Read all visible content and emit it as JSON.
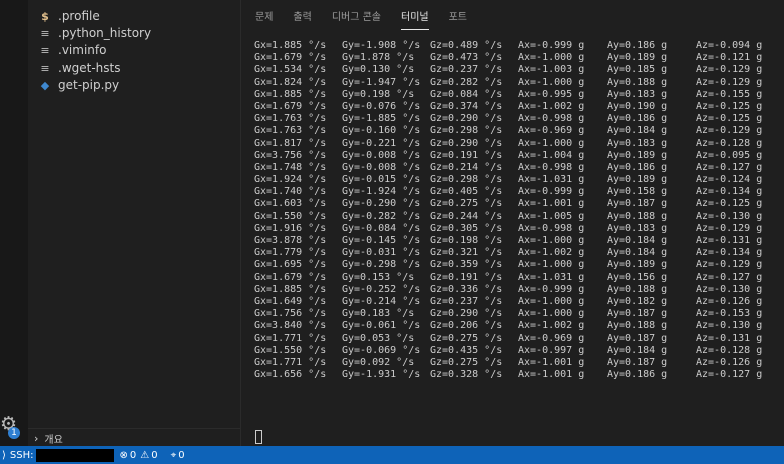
{
  "explorer": {
    "files": [
      {
        "name": ".profile",
        "icon": "dollar-icon"
      },
      {
        "name": ".python_history",
        "icon": "lines-icon"
      },
      {
        "name": ".viminfo",
        "icon": "lines-icon"
      },
      {
        "name": ".wget-hsts",
        "icon": "lines-icon"
      },
      {
        "name": "get-pip.py",
        "icon": "python-icon"
      }
    ],
    "outline_label": "개요"
  },
  "activity": {
    "settings_badge": "1"
  },
  "panel": {
    "tabs": [
      {
        "label": "문제"
      },
      {
        "label": "출력"
      },
      {
        "label": "디버그 콘솔"
      },
      {
        "label": "터미널",
        "active": true
      },
      {
        "label": "포트"
      }
    ],
    "terminal_lines": [
      [
        "Gx=1.885 °/s",
        "Gy=-1.908 °/s",
        "Gz=0.489 °/s",
        "Ax=-0.999 g",
        "Ay=0.186 g",
        "Az=-0.094 g"
      ],
      [
        "Gx=1.679 °/s",
        "Gy=1.878 °/s",
        "Gz=0.473 °/s",
        "Ax=-1.000 g",
        "Ay=0.189 g",
        "Az=-0.121 g"
      ],
      [
        "Gx=1.534 °/s",
        "Gy=0.130 °/s",
        "Gz=0.237 °/s",
        "Ax=-1.003 g",
        "Ay=0.185 g",
        "Az=-0.129 g"
      ],
      [
        "Gx=1.824 °/s",
        "Gy=-1.947 °/s",
        "Gz=0.282 °/s",
        "Ax=-1.000 g",
        "Ay=0.188 g",
        "Az=-0.129 g"
      ],
      [
        "Gx=1.885 °/s",
        "Gy=0.198 °/s",
        "Gz=0.084 °/s",
        "Ax=-0.995 g",
        "Ay=0.183 g",
        "Az=-0.155 g"
      ],
      [
        "Gx=1.679 °/s",
        "Gy=-0.076 °/s",
        "Gz=0.374 °/s",
        "Ax=-1.002 g",
        "Ay=0.190 g",
        "Az=-0.125 g"
      ],
      [
        "Gx=1.763 °/s",
        "Gy=-1.885 °/s",
        "Gz=0.290 °/s",
        "Ax=-0.998 g",
        "Ay=0.186 g",
        "Az=-0.125 g"
      ],
      [
        "Gx=1.763 °/s",
        "Gy=-0.160 °/s",
        "Gz=0.298 °/s",
        "Ax=-0.969 g",
        "Ay=0.184 g",
        "Az=-0.129 g"
      ],
      [
        "Gx=1.817 °/s",
        "Gy=-0.221 °/s",
        "Gz=0.290 °/s",
        "Ax=-1.000 g",
        "Ay=0.183 g",
        "Az=-0.128 g"
      ],
      [
        "Gx=3.756 °/s",
        "Gy=-0.008 °/s",
        "Gz=0.191 °/s",
        "Ax=-1.004 g",
        "Ay=0.189 g",
        "Az=-0.095 g"
      ],
      [
        "Gx=1.748 °/s",
        "Gy=-0.008 °/s",
        "Gz=0.214 °/s",
        "Ax=-0.998 g",
        "Ay=0.186 g",
        "Az=-0.127 g"
      ],
      [
        "Gx=1.924 °/s",
        "Gy=-0.015 °/s",
        "Gz=0.298 °/s",
        "Ax=-1.031 g",
        "Ay=0.189 g",
        "Az=-0.124 g"
      ],
      [
        "Gx=1.740 °/s",
        "Gy=-1.924 °/s",
        "Gz=0.405 °/s",
        "Ax=-0.999 g",
        "Ay=0.158 g",
        "Az=-0.134 g"
      ],
      [
        "Gx=1.603 °/s",
        "Gy=-0.290 °/s",
        "Gz=0.275 °/s",
        "Ax=-1.001 g",
        "Ay=0.187 g",
        "Az=-0.125 g"
      ],
      [
        "Gx=1.550 °/s",
        "Gy=-0.282 °/s",
        "Gz=0.244 °/s",
        "Ax=-1.005 g",
        "Ay=0.188 g",
        "Az=-0.130 g"
      ],
      [
        "Gx=1.916 °/s",
        "Gy=-0.084 °/s",
        "Gz=0.305 °/s",
        "Ax=-0.998 g",
        "Ay=0.183 g",
        "Az=-0.129 g"
      ],
      [
        "Gx=3.878 °/s",
        "Gy=-0.145 °/s",
        "Gz=0.198 °/s",
        "Ax=-1.000 g",
        "Ay=0.184 g",
        "Az=-0.131 g"
      ],
      [
        "Gx=1.779 °/s",
        "Gy=-0.031 °/s",
        "Gz=0.321 °/s",
        "Ax=-1.002 g",
        "Ay=0.184 g",
        "Az=-0.134 g"
      ],
      [
        "Gx=1.695 °/s",
        "Gy=-0.298 °/s",
        "Gz=0.359 °/s",
        "Ax=-1.000 g",
        "Ay=0.189 g",
        "Az=-0.129 g"
      ],
      [
        "Gx=1.679 °/s",
        "Gy=0.153 °/s",
        "Gz=0.191 °/s",
        "Ax=-1.031 g",
        "Ay=0.156 g",
        "Az=-0.127 g"
      ],
      [
        "Gx=1.885 °/s",
        "Gy=-0.252 °/s",
        "Gz=0.336 °/s",
        "Ax=-0.999 g",
        "Ay=0.188 g",
        "Az=-0.130 g"
      ],
      [
        "Gx=1.649 °/s",
        "Gy=-0.214 °/s",
        "Gz=0.237 °/s",
        "Ax=-1.000 g",
        "Ay=0.182 g",
        "Az=-0.126 g"
      ],
      [
        "Gx=1.756 °/s",
        "Gy=0.183 °/s",
        "Gz=0.290 °/s",
        "Ax=-1.000 g",
        "Ay=0.187 g",
        "Az=-0.153 g"
      ],
      [
        "Gx=3.840 °/s",
        "Gy=-0.061 °/s",
        "Gz=0.206 °/s",
        "Ax=-1.002 g",
        "Ay=0.188 g",
        "Az=-0.130 g"
      ],
      [
        "Gx=1.771 °/s",
        "Gy=0.053 °/s",
        "Gz=0.275 °/s",
        "Ax=-0.969 g",
        "Ay=0.187 g",
        "Az=-0.131 g"
      ],
      [
        "Gx=1.550 °/s",
        "Gy=-0.069 °/s",
        "Gz=0.435 °/s",
        "Ax=-0.997 g",
        "Ay=0.184 g",
        "Az=-0.128 g"
      ],
      [
        "Gx=1.771 °/s",
        "Gy=0.092 °/s",
        "Gz=0.275 °/s",
        "Ax=-1.001 g",
        "Ay=0.187 g",
        "Az=-0.126 g"
      ],
      [
        "Gx=1.656 °/s",
        "Gy=-1.931 °/s",
        "Gz=0.328 °/s",
        "Ax=-1.001 g",
        "Ay=0.186 g",
        "Az=-0.127 g"
      ]
    ]
  },
  "statusbar": {
    "remote_label": "SSH:",
    "errors": "0",
    "warnings": "0",
    "ports": "0",
    "accent": "#0e63b8"
  }
}
